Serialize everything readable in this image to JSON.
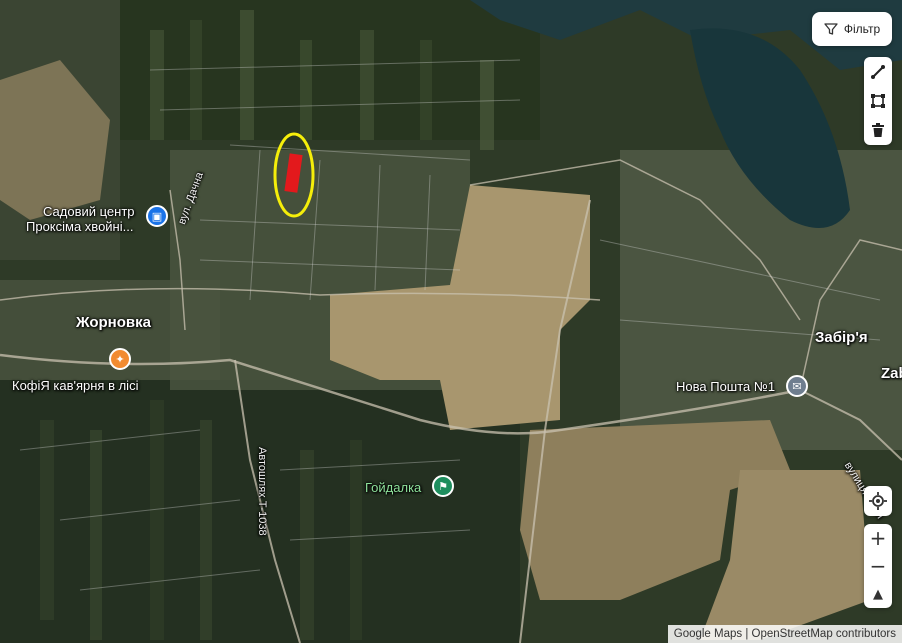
{
  "map": {
    "places": [
      {
        "name": "Жорновка"
      },
      {
        "name": "Забір'я"
      },
      {
        "name": "Zab"
      }
    ],
    "pois": [
      {
        "line1": "Садовий центр",
        "line2": "Проксіма хвойні...",
        "color": "#1a73e8"
      },
      {
        "line1": "КофіЯ кав'ярня в лісі",
        "color": "#f28b30"
      },
      {
        "line1": "Нова Пошта №1",
        "color": "#6f7e8f"
      },
      {
        "line1": "Гойдалка",
        "color": "#1e8e5e"
      }
    ],
    "roads": [
      {
        "name": "вул. Дачна"
      },
      {
        "name": "Автошлях Т-1038"
      },
      {
        "name": "вулиця Сосн"
      }
    ],
    "highlight": {
      "shape_color": "#e3191c",
      "outline_color": "#f5ee0a"
    }
  },
  "controls": {
    "filter_label": "Фільтр",
    "tools": [
      "line-tool-icon",
      "polygon-tool-icon",
      "delete-icon"
    ],
    "zoom_in": "+",
    "zoom_out": "−",
    "compass": "▲"
  },
  "attribution": "Google Maps | OpenStreetMap contributors"
}
